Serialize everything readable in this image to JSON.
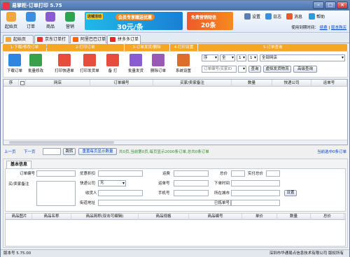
{
  "title": "易掌柜-订单打印 5.75",
  "toolbar": {
    "start_label": "起始页",
    "orders_label": "订单",
    "goods_label": "商品",
    "marketing_label": "营销"
  },
  "banner1": {
    "line1": "会员专享赠送优惠",
    "line2": "30元/条",
    "tag": "店铺活动"
  },
  "banner2": {
    "line1": "免费营销短信",
    "line2": "20条"
  },
  "right_buttons": {
    "settings": "设置",
    "log": "日志",
    "message": "消息",
    "help": "帮助"
  },
  "user": {
    "prefix": "使用到期时间：",
    "link1": "续费",
    "link2": "版本购买"
  },
  "tabs": [
    "起始页",
    "京东订单打印",
    "阿里巴巴订单",
    "拼多多订单"
  ],
  "sections": [
    "1-下载/修改订单",
    "2-打印订单",
    "3-订单发货/删除",
    "4-打印设置",
    "5-订单查询"
  ],
  "ribbon": [
    "下载订单",
    "批量修改",
    "打印快递单",
    "打印发货单",
    "备 打",
    "批量发货",
    "删除订单",
    "系统设置"
  ],
  "query": {
    "sel1": "序",
    "sel2": "全",
    "sel3": "1",
    "sel4": "1",
    "shop": "全部网店",
    "order_placeholder": "订单编号/买家ID",
    "btn_query": "查询",
    "btn_virtual": "虚拟发货物流",
    "btn_advanced": "高级查询"
  },
  "grid_columns": [
    "序",
    "",
    "网店",
    "订单编号",
    "买家/卖家备注",
    "数量",
    "快递公司",
    "运单号"
  ],
  "pager": {
    "prev": "上一页",
    "next": "下一页",
    "go": "跳转",
    "page_input": "",
    "refresh": "重置每页显示数量",
    "info": "共0页,当前第0页,每页显示2000条订单,总共0条订单",
    "selected": "当前选中0条订单"
  },
  "detail": {
    "tab": "基本信息",
    "order_no": "订单编号",
    "buyer_remark": "买/卖家备注",
    "discount": "优惠折扣",
    "express": "快递公司",
    "express_val": "无",
    "receiver": "收货人",
    "address": "街道地址",
    "freight": "运费",
    "waybill": "运单号",
    "phone": "手机号",
    "total": "总价",
    "paid": "实付总价",
    "order_time": "下单时间",
    "city": "所在城市",
    "completed": "已拣单号",
    "setup": "设置"
  },
  "product_columns": [
    "商品图片",
    "商品名称",
    "商品简称(双击可编辑)",
    "商品规格",
    "商品编号",
    "单价",
    "数量",
    "总价"
  ],
  "status": {
    "version": "版本号 5.75.00",
    "company": "深圳市华通易点信息技术有限公司 版权所有"
  },
  "colors": {
    "accent": "#f5a623",
    "title": "#4a72aa",
    "link": "#0044cc",
    "green": "#2b8c2b"
  }
}
